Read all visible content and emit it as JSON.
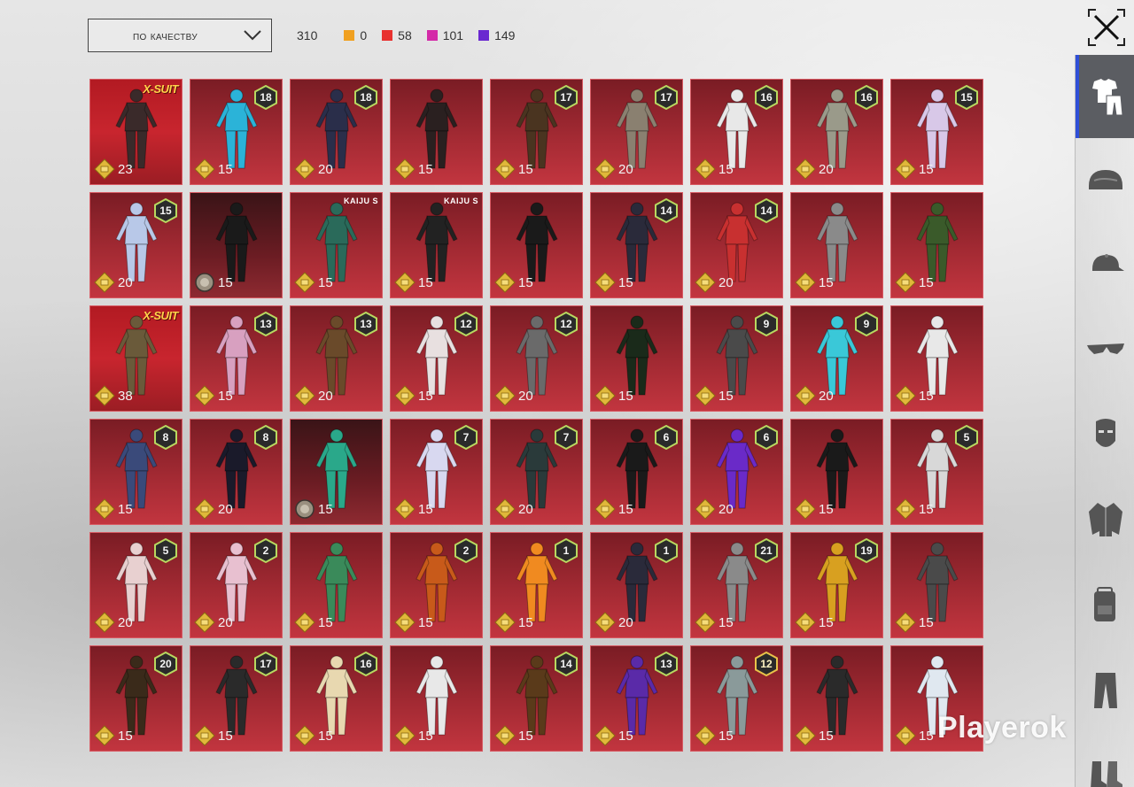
{
  "toolbar": {
    "sort_label": "по качеству",
    "total": "310",
    "counts": [
      {
        "color": "#f0a020",
        "value": "0"
      },
      {
        "color": "#e8312f",
        "value": "58"
      },
      {
        "color": "#d42aa8",
        "value": "101"
      },
      {
        "color": "#6a28d0",
        "value": "149"
      }
    ]
  },
  "sidebar": {
    "items": [
      {
        "icon": "outfit-icon",
        "active": true
      },
      {
        "icon": "helmet-icon",
        "active": false
      },
      {
        "icon": "cap-icon",
        "active": false
      },
      {
        "icon": "glasses-icon",
        "active": false
      },
      {
        "icon": "mask-icon",
        "active": false
      },
      {
        "icon": "jacket-icon",
        "active": false
      },
      {
        "icon": "backpack-icon",
        "active": false
      },
      {
        "icon": "pants-icon",
        "active": false
      },
      {
        "icon": "shoes-icon",
        "active": false
      }
    ]
  },
  "watermark": "Playerok",
  "items": [
    {
      "tag": "X-SUIT",
      "level": "",
      "price": "23",
      "style": "xsuit",
      "coin": "gold",
      "outfit": "#3a2a2a"
    },
    {
      "tag": "",
      "level": "18",
      "price": "15",
      "style": "",
      "coin": "gold",
      "outfit": "#2bb3d8"
    },
    {
      "tag": "",
      "level": "18",
      "price": "20",
      "style": "",
      "coin": "gold",
      "outfit": "#2a2e4a"
    },
    {
      "tag": "",
      "level": "",
      "price": "15",
      "style": "",
      "coin": "gold",
      "outfit": "#2a2020"
    },
    {
      "tag": "",
      "level": "17",
      "price": "15",
      "style": "",
      "coin": "gold",
      "outfit": "#4a3420"
    },
    {
      "tag": "",
      "level": "17",
      "price": "20",
      "style": "",
      "coin": "gold",
      "outfit": "#8a8070"
    },
    {
      "tag": "",
      "level": "16",
      "price": "15",
      "style": "",
      "coin": "gold",
      "outfit": "#e8e8e8"
    },
    {
      "tag": "",
      "level": "16",
      "price": "20",
      "style": "",
      "coin": "gold",
      "outfit": "#9a9a8a"
    },
    {
      "tag": "",
      "level": "15",
      "price": "15",
      "style": "",
      "coin": "gold",
      "outfit": "#d8c8e8"
    },
    {
      "tag": "",
      "level": "15",
      "price": "20",
      "style": "",
      "coin": "gold",
      "outfit": "#b8c8e8"
    },
    {
      "tag": "",
      "level": "",
      "price": "15",
      "style": "dark",
      "coin": "silver",
      "outfit": "#1a1a1a"
    },
    {
      "tag": "KAIJU S",
      "level": "",
      "price": "15",
      "style": "",
      "coin": "gold",
      "outfit": "#2a6a5a"
    },
    {
      "tag": "KAIJU S",
      "level": "",
      "price": "15",
      "style": "",
      "coin": "gold",
      "outfit": "#222222"
    },
    {
      "tag": "",
      "level": "",
      "price": "15",
      "style": "",
      "coin": "gold",
      "outfit": "#1a1a1a"
    },
    {
      "tag": "",
      "level": "14",
      "price": "15",
      "style": "",
      "coin": "gold",
      "outfit": "#2a2a3a"
    },
    {
      "tag": "",
      "level": "14",
      "price": "20",
      "style": "",
      "coin": "gold",
      "outfit": "#c83030"
    },
    {
      "tag": "",
      "level": "",
      "price": "15",
      "style": "",
      "coin": "gold",
      "outfit": "#8a8a8a"
    },
    {
      "tag": "",
      "level": "",
      "price": "15",
      "style": "",
      "coin": "gold",
      "outfit": "#3a5a2a"
    },
    {
      "tag": "X-SUIT",
      "level": "",
      "price": "38",
      "style": "xsuit",
      "coin": "gold",
      "outfit": "#6a5a3a"
    },
    {
      "tag": "",
      "level": "13",
      "price": "15",
      "style": "",
      "coin": "gold",
      "outfit": "#d8a0c0"
    },
    {
      "tag": "",
      "level": "13",
      "price": "20",
      "style": "",
      "coin": "gold",
      "outfit": "#6a4a2a"
    },
    {
      "tag": "",
      "level": "12",
      "price": "15",
      "style": "",
      "coin": "gold",
      "outfit": "#e8e0e0"
    },
    {
      "tag": "",
      "level": "12",
      "price": "20",
      "style": "",
      "coin": "gold",
      "outfit": "#6a6a6a"
    },
    {
      "tag": "",
      "level": "",
      "price": "15",
      "style": "",
      "coin": "gold",
      "outfit": "#1a2a1a"
    },
    {
      "tag": "",
      "level": "9",
      "price": "15",
      "style": "",
      "coin": "gold",
      "outfit": "#4a4a4a"
    },
    {
      "tag": "",
      "level": "9",
      "price": "20",
      "style": "",
      "coin": "gold",
      "outfit": "#3ac8d8"
    },
    {
      "tag": "",
      "level": "",
      "price": "15",
      "style": "",
      "coin": "gold",
      "outfit": "#e8e8e8"
    },
    {
      "tag": "",
      "level": "8",
      "price": "15",
      "style": "",
      "coin": "gold",
      "outfit": "#3a4a7a"
    },
    {
      "tag": "",
      "level": "8",
      "price": "20",
      "style": "",
      "coin": "gold",
      "outfit": "#1a1a2a"
    },
    {
      "tag": "",
      "level": "",
      "price": "15",
      "style": "dark",
      "coin": "silver",
      "outfit": "#2aa88a"
    },
    {
      "tag": "",
      "level": "7",
      "price": "15",
      "style": "",
      "coin": "gold",
      "outfit": "#d8d8f0"
    },
    {
      "tag": "",
      "level": "7",
      "price": "20",
      "style": "",
      "coin": "gold",
      "outfit": "#2a3a3a"
    },
    {
      "tag": "",
      "level": "6",
      "price": "15",
      "style": "",
      "coin": "gold",
      "outfit": "#1a1a1a"
    },
    {
      "tag": "",
      "level": "6",
      "price": "20",
      "style": "",
      "coin": "gold",
      "outfit": "#6a2ac8"
    },
    {
      "tag": "",
      "level": "",
      "price": "15",
      "style": "",
      "coin": "gold",
      "outfit": "#1a1a1a"
    },
    {
      "tag": "",
      "level": "5",
      "price": "15",
      "style": "",
      "coin": "gold",
      "outfit": "#d8d8d8"
    },
    {
      "tag": "",
      "level": "5",
      "price": "20",
      "style": "",
      "coin": "gold",
      "outfit": "#e8d0d0"
    },
    {
      "tag": "",
      "level": "2",
      "price": "20",
      "style": "",
      "coin": "gold",
      "outfit": "#e8c0d0"
    },
    {
      "tag": "",
      "level": "",
      "price": "15",
      "style": "",
      "coin": "gold",
      "outfit": "#3a8a5a"
    },
    {
      "tag": "",
      "level": "2",
      "price": "15",
      "style": "",
      "coin": "gold",
      "outfit": "#c85a1a"
    },
    {
      "tag": "",
      "level": "1",
      "price": "15",
      "style": "",
      "coin": "gold",
      "outfit": "#f08a20"
    },
    {
      "tag": "",
      "level": "1",
      "price": "20",
      "style": "",
      "coin": "gold",
      "outfit": "#2a2a3a"
    },
    {
      "tag": "",
      "level": "21",
      "price": "15",
      "style": "",
      "coin": "gold",
      "outfit": "#8a8a8a"
    },
    {
      "tag": "",
      "level": "19",
      "price": "15",
      "style": "",
      "coin": "gold",
      "outfit": "#d8a020"
    },
    {
      "tag": "",
      "level": "",
      "price": "15",
      "style": "",
      "coin": "gold",
      "outfit": "#4a4a4a"
    },
    {
      "tag": "",
      "level": "20",
      "price": "15",
      "style": "",
      "coin": "gold",
      "outfit": "#3a2a1a"
    },
    {
      "tag": "",
      "level": "17",
      "price": "15",
      "style": "",
      "coin": "gold",
      "outfit": "#2a2a2a"
    },
    {
      "tag": "",
      "level": "16",
      "price": "15",
      "style": "",
      "coin": "gold",
      "outfit": "#e8d8b0"
    },
    {
      "tag": "",
      "level": "",
      "price": "15",
      "style": "",
      "coin": "gold",
      "outfit": "#e8e8e8"
    },
    {
      "tag": "",
      "level": "14",
      "price": "15",
      "style": "",
      "coin": "gold",
      "outfit": "#5a3a1a"
    },
    {
      "tag": "",
      "level": "13",
      "price": "15",
      "style": "",
      "coin": "gold",
      "outfit": "#5a2aa8"
    },
    {
      "tag": "",
      "level": "12",
      "price": "15",
      "style": "",
      "coin": "gold",
      "outfit": "#8a9a9a",
      "level_style": "gold"
    },
    {
      "tag": "",
      "level": "",
      "price": "15",
      "style": "",
      "coin": "gold",
      "outfit": "#2a2a2a"
    },
    {
      "tag": "",
      "level": "",
      "price": "15",
      "style": "",
      "coin": "gold",
      "outfit": "#e0e8f0"
    }
  ]
}
